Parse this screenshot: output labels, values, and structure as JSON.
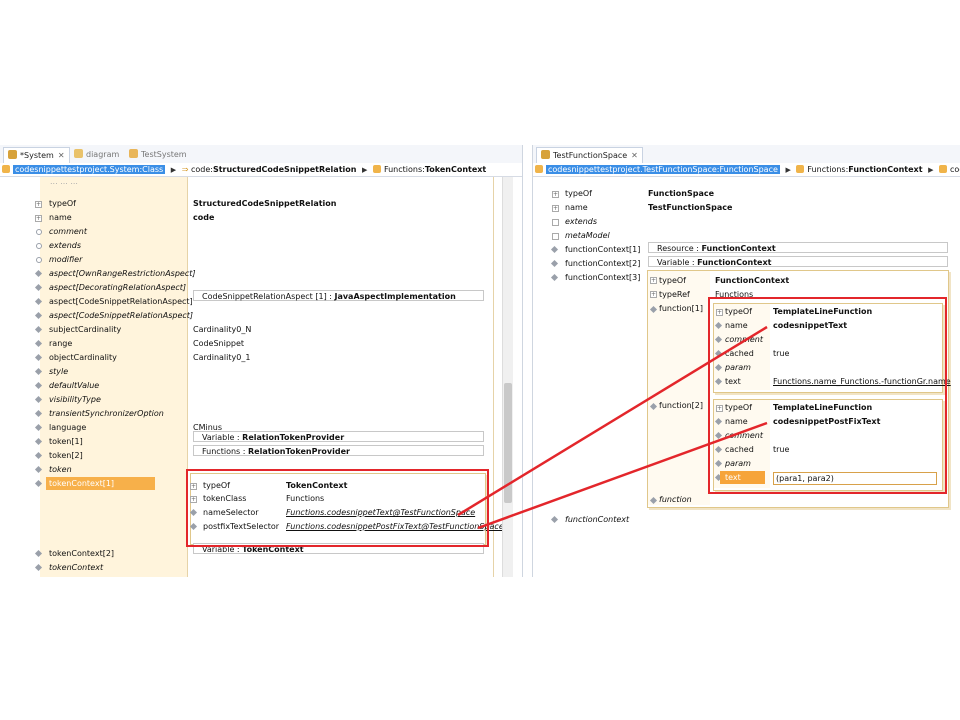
{
  "colors": {
    "accent": "#3a8ee6",
    "highlight": "#f6a43a",
    "annotation_red": "#e3262b",
    "gutter": "#fff4dc"
  },
  "left": {
    "tabs": [
      {
        "label": "*System",
        "icon": "model-icon",
        "active": true
      },
      {
        "label": "diagram",
        "icon": "diagram-icon",
        "active": false
      },
      {
        "label": "TestSystem",
        "icon": "system-icon",
        "active": false
      }
    ],
    "breadcrumb": {
      "selected": "codesnippettestproject.System:Class",
      "item2_prefix": "code:",
      "item2_bold": "StructuredCodeSnippetRelation",
      "item3_prefix": "Functions:",
      "item3_bold": "TokenContext"
    },
    "cut_row": "... ... ...",
    "rows": [
      {
        "label": "typeOf",
        "italic": false,
        "value": "StructuredCodeSnippetRelation",
        "bold": true
      },
      {
        "label": "name",
        "italic": false,
        "value": "code",
        "bold": true
      },
      {
        "label": "comment",
        "italic": true,
        "value": ""
      },
      {
        "label": "extends",
        "italic": true,
        "value": ""
      },
      {
        "label": "modifier",
        "italic": true,
        "value": ""
      },
      {
        "label": "aspect[OwnRangeRestrictionAspect]",
        "italic": true,
        "value": ""
      },
      {
        "label": "aspect[DecoratingRelationAspect]",
        "italic": true,
        "value": ""
      },
      {
        "label": "aspect[CodeSnippetRelationAspect]",
        "italic": false,
        "value": ""
      },
      {
        "label": "aspect[CodeSnippetRelationAspect]",
        "italic": true,
        "value": ""
      },
      {
        "label": "subjectCardinality",
        "italic": false,
        "value": "Cardinality0_N"
      },
      {
        "label": "range",
        "italic": false,
        "value": "CodeSnippet"
      },
      {
        "label": "objectCardinality",
        "italic": false,
        "value": "Cardinality0_1"
      },
      {
        "label": "style",
        "italic": true,
        "value": ""
      },
      {
        "label": "defaultValue",
        "italic": true,
        "value": ""
      },
      {
        "label": "visibilityType",
        "italic": true,
        "value": ""
      },
      {
        "label": "transientSynchronizerOption",
        "italic": true,
        "value": ""
      },
      {
        "label": "language",
        "italic": false,
        "value": "CMinus"
      },
      {
        "label": "token[1]",
        "italic": false,
        "value": ""
      },
      {
        "label": "token[2]",
        "italic": false,
        "value": ""
      },
      {
        "label": "token",
        "italic": true,
        "value": ""
      },
      {
        "label": "tokenContext[1]",
        "italic": false,
        "value": ""
      },
      {
        "label": "tokenContext[2]",
        "italic": false,
        "value": ""
      },
      {
        "label": "tokenContext",
        "italic": true,
        "value": ""
      }
    ],
    "aspect_box": {
      "prefix": "CodeSnippetRelationAspect [1] : ",
      "bold": "JavaAspectImplementation"
    },
    "token1_box": {
      "prefix": "Variable : ",
      "bold": "RelationTokenProvider"
    },
    "token2_box": {
      "prefix": "Functions : ",
      "bold": "RelationTokenProvider"
    },
    "token_context_box": {
      "rows": [
        {
          "label": "typeOf",
          "value": "TokenContext",
          "bold": true,
          "link": false
        },
        {
          "label": "tokenClass",
          "value": "Functions",
          "bold": false,
          "link": false
        },
        {
          "label": "nameSelector",
          "value": "Functions.codesnippetText@TestFunctionSpace",
          "bold": false,
          "link": true
        },
        {
          "label": "postfixTextSelector",
          "value": "Functions.codesnippetPostFixText@TestFunctionSpace",
          "bold": false,
          "link": true
        }
      ]
    },
    "token_context2_box": {
      "prefix": "Variable : ",
      "bold": "TokenContext"
    }
  },
  "right": {
    "tab": {
      "label": "TestFunctionSpace",
      "icon": "function-space-icon"
    },
    "breadcrumb": {
      "selected": "codesnippettestproject.TestFunctionSpace:FunctionSpace",
      "item2_prefix": "Functions:",
      "item2_bold": "FunctionContext",
      "item3": "codesnippetPost"
    },
    "rows": [
      {
        "label": "typeOf",
        "italic": false,
        "value": "FunctionSpace"
      },
      {
        "label": "name",
        "italic": false,
        "value": "TestFunctionSpace"
      },
      {
        "label": "extends",
        "italic": true,
        "value": ""
      },
      {
        "label": "metaModel",
        "italic": true,
        "value": ""
      },
      {
        "label": "functionContext[1]",
        "italic": false,
        "value": ""
      },
      {
        "label": "functionContext[2]",
        "italic": false,
        "value": ""
      },
      {
        "label": "functionContext[3]",
        "italic": false,
        "value": ""
      },
      {
        "label": "functionContext",
        "italic": true,
        "value": ""
      }
    ],
    "fc1_box": {
      "prefix": "Resource : ",
      "bold": "FunctionContext"
    },
    "fc2_box": {
      "prefix": "Variable : ",
      "bold": "FunctionContext"
    },
    "fc3": {
      "typeOf_label": "typeOf",
      "typeOf_value": "FunctionContext",
      "typeRef_label": "typeRef",
      "typeRef_value": "Functions",
      "function1_label": "function[1]",
      "function2_label": "function[2]",
      "function_label": "function"
    },
    "func1": {
      "rows": [
        {
          "label": "typeOf",
          "italic": false,
          "value": "TemplateLineFunction",
          "bold": true
        },
        {
          "label": "name",
          "italic": false,
          "value": "codesnippetText",
          "bold": true
        },
        {
          "label": "comment",
          "italic": true,
          "value": ""
        },
        {
          "label": "cached",
          "italic": false,
          "value": "true"
        },
        {
          "label": "param",
          "italic": true,
          "value": ""
        },
        {
          "label": "text",
          "italic": false,
          "value": "Functions.name_Functions.-functionGr.name",
          "link": true
        }
      ]
    },
    "func2": {
      "rows": [
        {
          "label": "typeOf",
          "italic": false,
          "value": "TemplateLineFunction",
          "bold": true
        },
        {
          "label": "name",
          "italic": false,
          "value": "codesnippetPostFixText",
          "bold": true
        },
        {
          "label": "comment",
          "italic": true,
          "value": ""
        },
        {
          "label": "cached",
          "italic": false,
          "value": "true"
        },
        {
          "label": "param",
          "italic": true,
          "value": ""
        },
        {
          "label": "text",
          "italic": false,
          "value": "(para1, para2)"
        }
      ]
    }
  }
}
